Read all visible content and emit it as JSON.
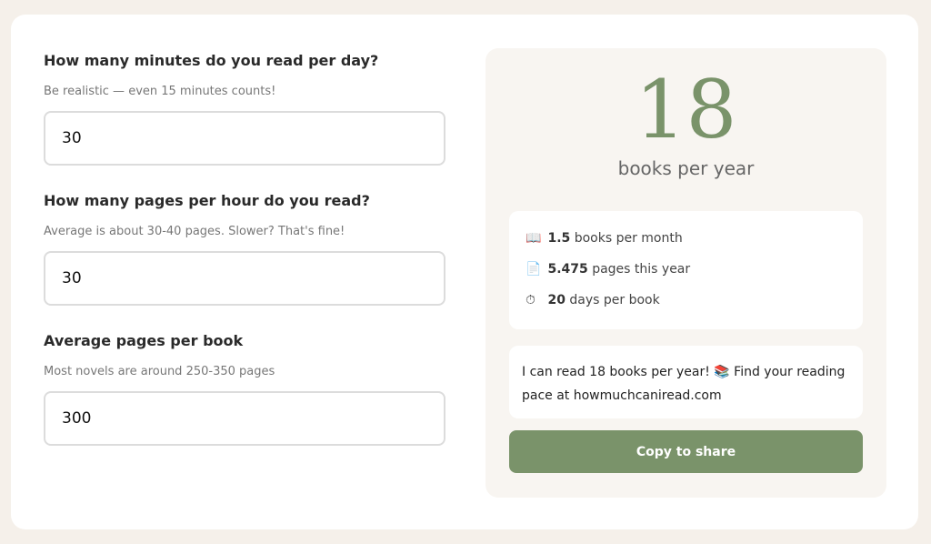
{
  "questions": [
    {
      "title": "How many minutes do you read per day?",
      "hint": "Be realistic — even 15 minutes counts!",
      "value": "30"
    },
    {
      "title": "How many pages per hour do you read?",
      "hint": "Average is about 30-40 pages. Slower? That's fine!",
      "value": "30"
    },
    {
      "title": "Average pages per book",
      "hint": "Most novels are around 250-350 pages",
      "value": "300"
    }
  ],
  "result": {
    "number": "18",
    "label": "books per year",
    "stats": [
      {
        "icon": "📖",
        "value": "1.5",
        "text": "books per month"
      },
      {
        "icon": "📄",
        "value": "5.475",
        "text": "pages this year"
      },
      {
        "icon": "⏱",
        "value": "20",
        "text": "days per book"
      }
    ],
    "share_text": "I can read 18 books per year! 📚 Find your reading pace at howmuchcaniread.com",
    "share_button": "Copy to share"
  },
  "colors": {
    "accent": "#7a936a",
    "panel": "#f8f5f1",
    "background": "#f5f0ea"
  }
}
